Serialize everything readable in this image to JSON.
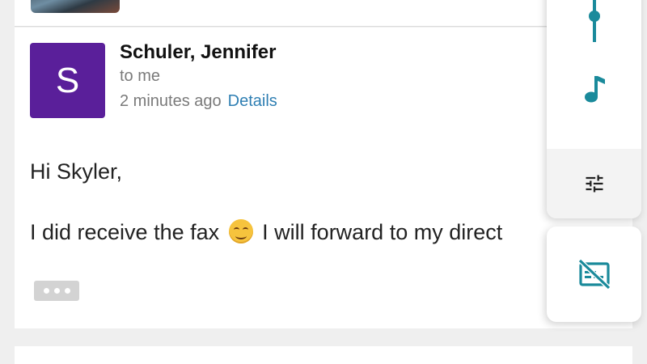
{
  "message": {
    "avatar_letter": "S",
    "sender": "Schuler, Jennifer",
    "recipient": "to me",
    "time": "2 minutes ago",
    "details_label": "Details",
    "greeting": "Hi Skyler,",
    "body_before_emoji": "I did receive the fax",
    "body_after_emoji": "I will forward to my direct",
    "colors": {
      "avatar_bg": "#5a1f9a",
      "link": "#2f7fb3",
      "icon_accent": "#1a8a9b"
    }
  },
  "side_panel": {
    "icons": [
      "slider-icon",
      "music-note-icon",
      "tune-icon",
      "subtitles-off-icon"
    ]
  },
  "emoji": "smiling-face-emoji"
}
